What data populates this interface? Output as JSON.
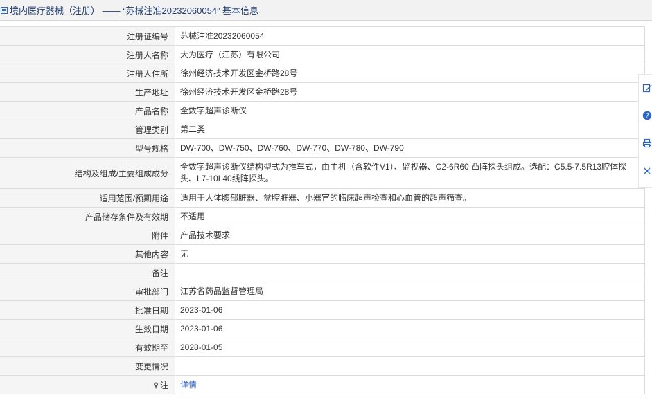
{
  "header": {
    "title": "境内医疗器械（注册） —— “苏械注准20232060054” 基本信息",
    "icon": "document-icon"
  },
  "rows": [
    {
      "label": "注册证编号",
      "value": "苏械注准20232060054"
    },
    {
      "label": "注册人名称",
      "value": "大为医疗（江苏）有限公司"
    },
    {
      "label": "注册人住所",
      "value": "徐州经济技术开发区金桥路28号"
    },
    {
      "label": "生产地址",
      "value": "徐州经济技术开发区金桥路28号"
    },
    {
      "label": "产品名称",
      "value": "全数字超声诊断仪"
    },
    {
      "label": "管理类别",
      "value": "第二类"
    },
    {
      "label": "型号规格",
      "value": "DW-700、DW-750、DW-760、DW-770、DW-780、DW-790"
    },
    {
      "label": "结构及组成/主要组成成分",
      "value": "全数字超声诊断仪结构型式为推车式，由主机（含软件V1）、监视器、C2-6R60 凸阵探头组成。选配：C5.5-7.5R13腔体探头、L7-10L40线阵探头。"
    },
    {
      "label": "适用范围/预期用途",
      "value": "适用于人体腹部脏器、盆腔脏器、小器官的临床超声检查和心血管的超声筛查。"
    },
    {
      "label": "产品储存条件及有效期",
      "value": "不适用"
    },
    {
      "label": "附件",
      "value": "产品技术要求"
    },
    {
      "label": "其他内容",
      "value": "无"
    },
    {
      "label": "备注",
      "value": ""
    },
    {
      "label": "审批部门",
      "value": "江苏省药品监督管理局"
    },
    {
      "label": "批准日期",
      "value": "2023-01-06"
    },
    {
      "label": "生效日期",
      "value": "2023-01-06"
    },
    {
      "label": "有效期至",
      "value": "2028-01-05"
    },
    {
      "label": "变更情况",
      "value": ""
    },
    {
      "label": "注",
      "value": "详情",
      "icon": "pin-icon"
    }
  ],
  "side_toolbar": [
    "edit-icon",
    "help-icon",
    "print-icon",
    "close-icon"
  ],
  "colors": {
    "link": "#2a65c8",
    "header_text": "#1f3b6f",
    "label_bg": "#f5f5f5",
    "border": "#dcdcdc"
  }
}
